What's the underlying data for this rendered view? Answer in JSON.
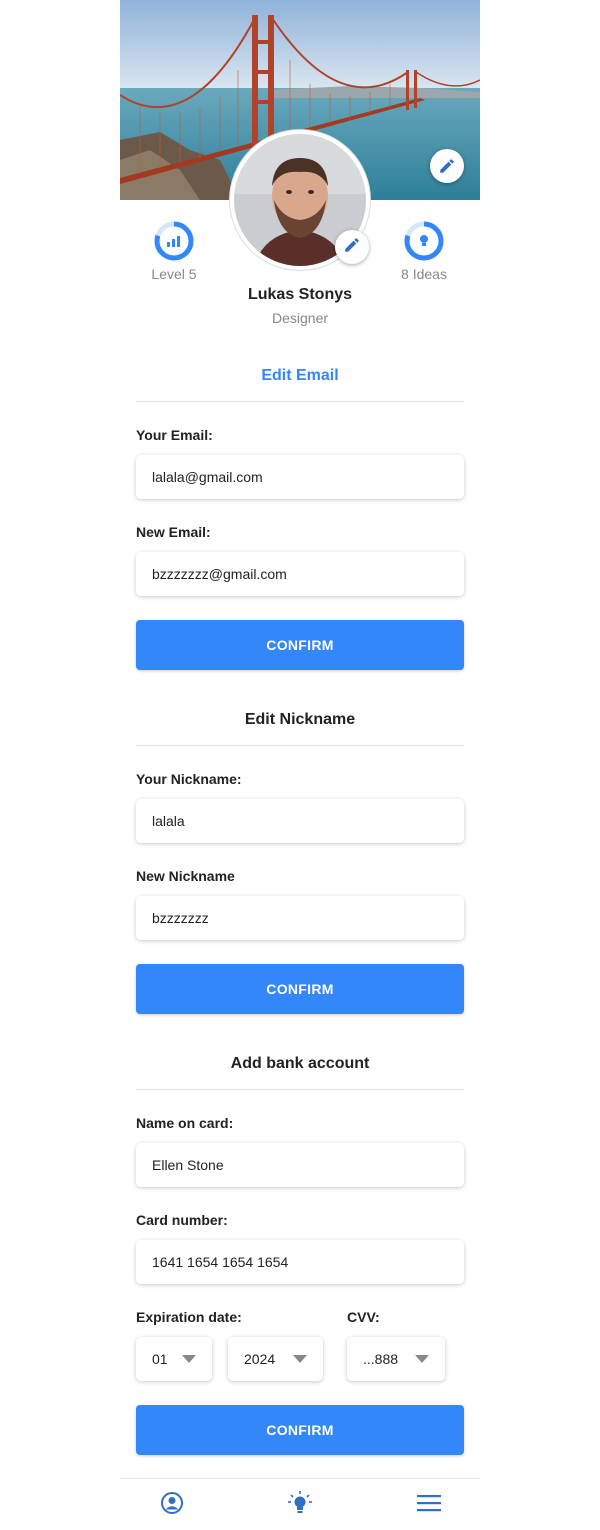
{
  "colors": {
    "accent": "#3387f8",
    "icon_blue": "#2f6fc4",
    "muted": "#888888"
  },
  "profile": {
    "name": "Lukas Stonys",
    "role": "Designer",
    "level_label": "Level 5",
    "level_progress": 0.8,
    "ideas_label": "8 Ideas",
    "ideas_progress": 0.8
  },
  "email_section": {
    "title": "Edit Email",
    "current_label": "Your Email:",
    "current_value": "lalala@gmail.com",
    "new_label": "New Email:",
    "new_value": "bzzzzzzz@gmail.com",
    "confirm_label": "CONFIRM"
  },
  "nickname_section": {
    "title": "Edit Nickname",
    "current_label": "Your Nickname:",
    "current_value": "lalala",
    "new_label": "New Nickname",
    "new_value": "bzzzzzzz",
    "confirm_label": "CONFIRM"
  },
  "bank_section": {
    "title": "Add bank account",
    "name_label": "Name on card:",
    "name_value": "Ellen Stone",
    "number_label": "Card number:",
    "number_value": "1641 1654 1654 1654",
    "expiration_label": "Expiration date:",
    "month_value": "01",
    "year_value": "2024",
    "cvv_label": "CVV:",
    "cvv_value": "...888",
    "confirm_label": "CONFIRM"
  },
  "tabbar": {
    "icons": [
      "profile-icon",
      "lightbulb-icon",
      "menu-icon"
    ]
  }
}
